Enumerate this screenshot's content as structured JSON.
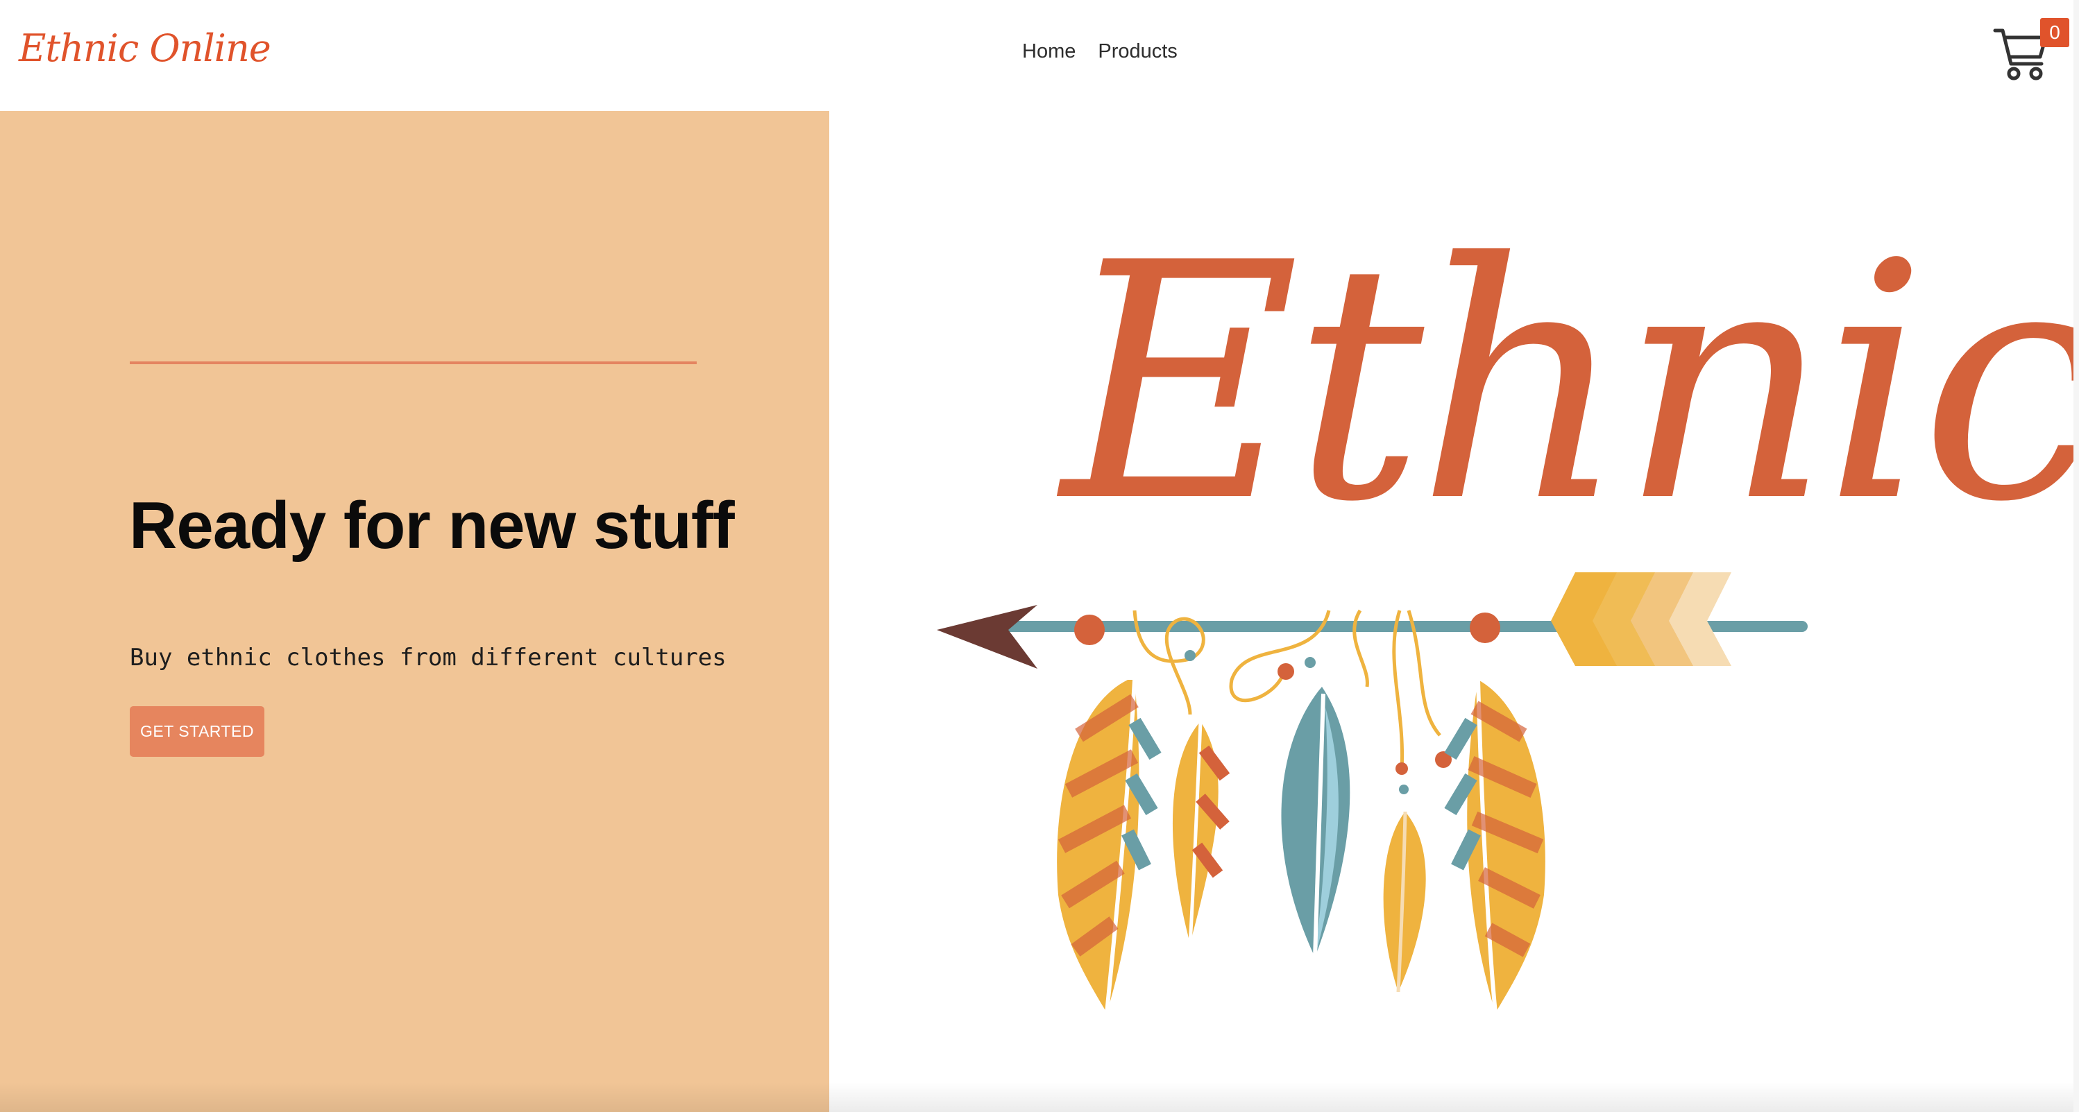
{
  "header": {
    "brand": "Ethnic Online",
    "nav": [
      {
        "label": "Home"
      },
      {
        "label": "Products"
      }
    ],
    "cart": {
      "icon": "shopping-cart-icon",
      "count": "0"
    }
  },
  "hero": {
    "title": "Ready for new stuff",
    "subtitle": "Buy ethnic clothes from different cultures",
    "cta_label": "GET STARTED",
    "logo_text": "Ethnic"
  },
  "colors": {
    "brand": "#e0532b",
    "hero_panel": "#f1c596",
    "divider": "#e48460",
    "button": "#e6855e",
    "logo_orange": "#d4623b",
    "logo_teal": "#6a9ea6",
    "logo_yellow": "#efb33f",
    "logo_light_blue": "#9ecfdc",
    "logo_brown": "#6b3a33"
  }
}
